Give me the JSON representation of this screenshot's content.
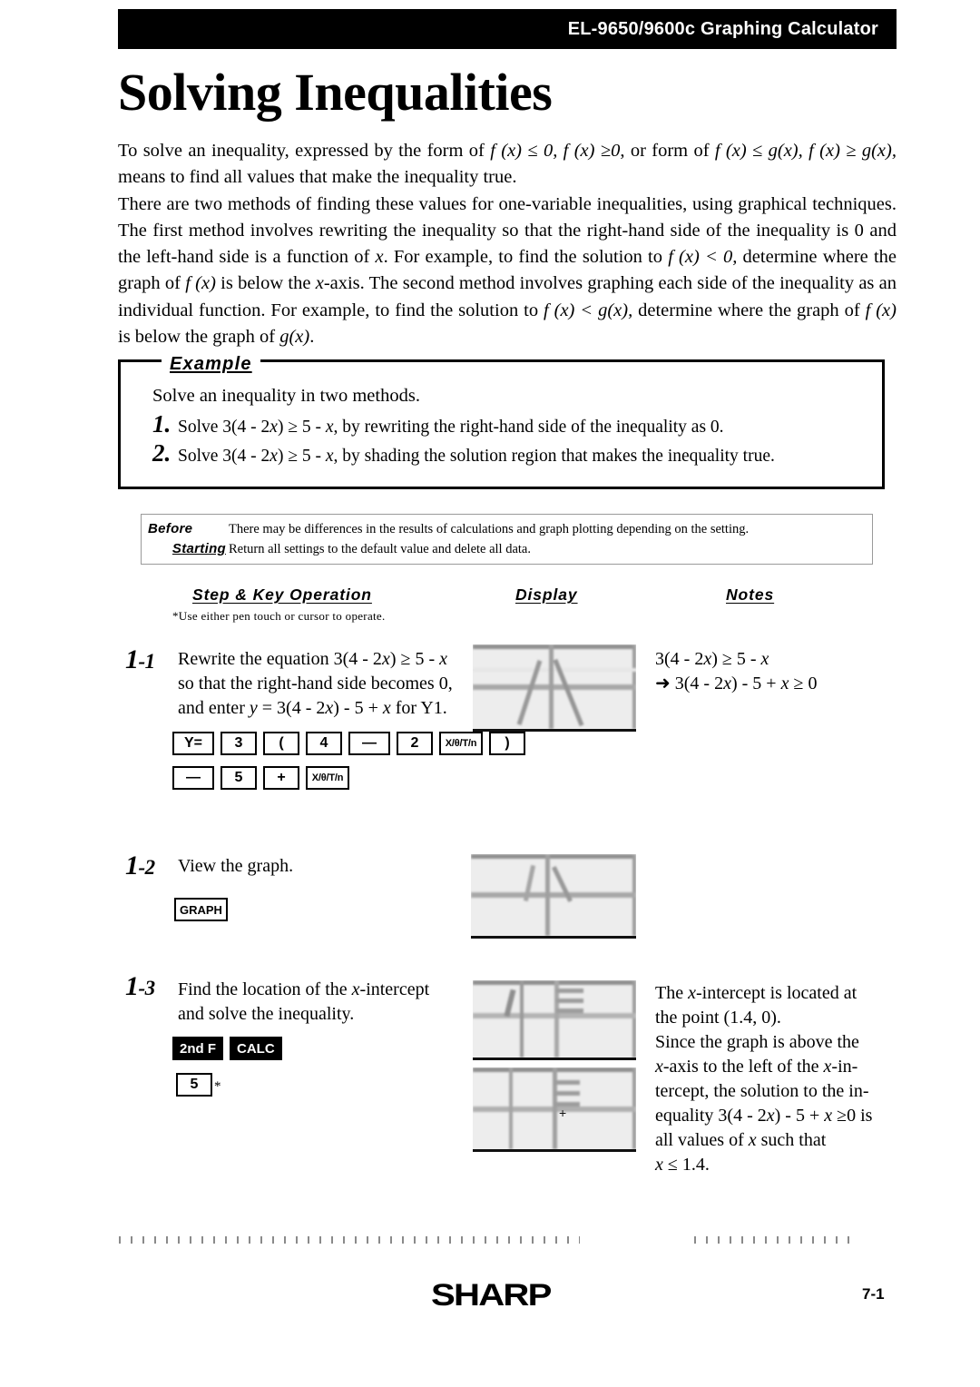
{
  "header": {
    "title": "EL-9650/9600c Graphing Calculator"
  },
  "page_title": "Solving Inequalities",
  "intro": {
    "para1_a": "To solve an inequality, expressed by the form of ",
    "para1_math1": "f (x) ≤ 0,  f (x) ≥0",
    "para1_b": ", or form of ",
    "para1_math2": "f (x) ≤ g(x), f (x) ≥ g(x),",
    "para1_c": " means to find all values that make the inequality true.",
    "para2_a": "There are two methods of finding these values for one-variable inequalities, using graphical techniques. The first method involves rewriting the inequality so that the right-hand side of the inequality is 0 and the left-hand side is a function of ",
    "para2_x1": "x",
    "para2_b": ". For example, to find the solution to ",
    "para2_math1": "f (x)  < 0,",
    "para2_c": " determine where the graph of ",
    "para2_math2": "f (x)",
    "para2_d": " is below the ",
    "para2_x2": "x",
    "para2_e": "-axis. The second method involves graphing each side of the inequality as an individual function. For example, to find the solution to ",
    "para2_math3": "f (x)  < g(x),",
    "para2_f": " determine where the graph of ",
    "para2_math4": "f (x)",
    "para2_g": " is below the graph of ",
    "para2_math5": "g(x)",
    "para2_h": "."
  },
  "example": {
    "label": "Example",
    "lead": "Solve an inequality in two methods.",
    "items": [
      {
        "number": "1.",
        "text_a": "Solve 3(4 - 2",
        "text_x": "x",
        "text_b": ") ≥ 5 - ",
        "text_x2": "x",
        "text_c": ", by rewriting the right-hand side of the inequality as 0."
      },
      {
        "number": "2.",
        "text_a": "Solve 3(4 - 2",
        "text_x": "x",
        "text_b": ") ≥ 5 - ",
        "text_x2": "x",
        "text_c": ", by shading the solution region that makes the inequality true."
      }
    ]
  },
  "before_starting": {
    "label_line1": "Before",
    "label_line2": "Starting",
    "text_line1": "There may be differences in the results of calculations and graph plotting depending on the setting.",
    "text_line2": "Return all settings to the default value and delete all data."
  },
  "columns": {
    "step": "Step & Key Operation",
    "display": "Display",
    "notes": "Notes",
    "footnote": "*Use either pen touch or cursor to operate."
  },
  "steps": [
    {
      "num_big": "1",
      "num_small": "-1",
      "text_line1_a": "Rewrite the equation 3(4 - 2",
      "text_line1_x": "x",
      "text_line1_b": ") ≥ 5 - ",
      "text_line1_x2": "x",
      "text_line2": "so that the right-hand side becomes 0,",
      "text_line3_a": "and enter ",
      "text_line3_y": "y",
      "text_line3_b": " = 3(4 - 2",
      "text_line3_x": "x",
      "text_line3_c": ") - 5 + ",
      "text_line3_x2": "x",
      "text_line3_d": "  for Y1.",
      "keys_row1": [
        "Y=",
        "3",
        "(",
        "4",
        "—",
        "2",
        "X/θ/T/n",
        ")"
      ],
      "keys_row2": [
        "—",
        "5",
        "+",
        "X/θ/T/n"
      ],
      "notes_line1_a": "3(4 - 2",
      "notes_line1_x": "x",
      "notes_line1_b": ") ≥ 5 - ",
      "notes_line1_x2": "x",
      "notes_line2_arrow": "➜",
      "notes_line2_a": " 3(4 - 2",
      "notes_line2_x": "x",
      "notes_line2_b": ") - 5 + ",
      "notes_line2_x2": "x",
      "notes_line2_c": " ≥ 0"
    },
    {
      "num_big": "1",
      "num_small": "-2",
      "text_line1": "View the graph.",
      "keys_row1": [
        "GRAPH"
      ]
    },
    {
      "num_big": "1",
      "num_small": "-3",
      "text_line1_a": "Find the location of the ",
      "text_line1_x": "x",
      "text_line1_b": "-intercept",
      "text_line2": "and solve the inequality.",
      "keys_inverted": [
        "2nd F",
        "CALC"
      ],
      "keys_row2": [
        "5"
      ],
      "key_star": "*",
      "notes_l1_a": "The ",
      "notes_l1_x": "x",
      "notes_l1_b": "-intercept is located at",
      "notes_l2": "the point (1.4, 0).",
      "notes_l3": "Since the graph is above the",
      "notes_l4_x": "x",
      "notes_l4_a": "-axis to the left of the ",
      "notes_l4_x2": "x",
      "notes_l4_b": "-in-",
      "notes_l5": "tercept, the solution to the in-",
      "notes_l6_a": "equality  3(4 - 2",
      "notes_l6_x": "x",
      "notes_l6_b": ") - 5 + ",
      "notes_l6_x2": "x",
      "notes_l6_c": " ≥0 is",
      "notes_l7_a": "all values of ",
      "notes_l7_x": "x",
      "notes_l7_b": " such that",
      "notes_l8_x": "x",
      "notes_l8_a": " ≤ 1.4."
    }
  ],
  "footer": {
    "logo": "SHARP",
    "page_number": "7-1"
  },
  "colors": {
    "header_bg": "#000000",
    "header_text": "#ffffff",
    "body_text": "#000000",
    "screen_bg": "#ededed",
    "box_border": "#000000",
    "before_border": "#9a9a9a"
  }
}
